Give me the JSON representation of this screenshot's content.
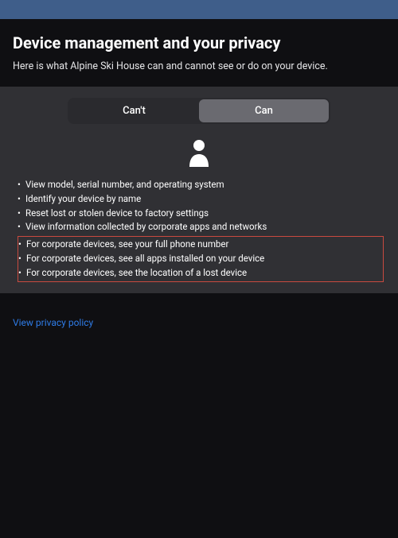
{
  "header": {
    "title": "Device management and your privacy",
    "subtitle": "Here is what Alpine Ski House can and cannot see or do on your device."
  },
  "tabs": {
    "cant_label": "Can't",
    "can_label": "Can"
  },
  "permissions": {
    "normal": [
      "View model, serial number, and operating system",
      "Identify your device by name",
      "Reset lost or stolen device to factory settings",
      "View information collected by corporate apps and networks"
    ],
    "highlighted": [
      "For corporate devices, see your full phone number",
      "For corporate devices, see all apps installed on your device",
      "For corporate devices, see the location of a lost device"
    ]
  },
  "footer": {
    "privacy_link": "View privacy policy"
  }
}
